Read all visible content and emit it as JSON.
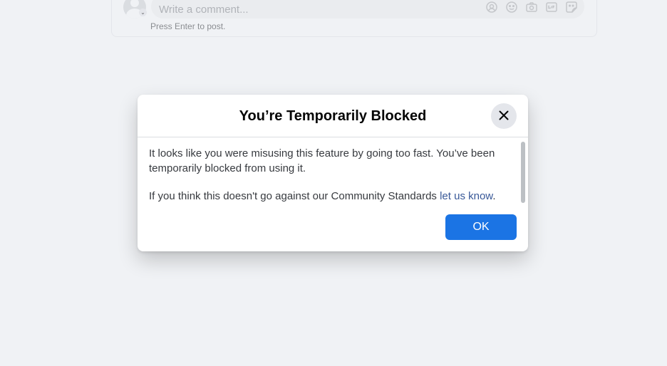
{
  "comment_box": {
    "placeholder": "Write a comment...",
    "hint": "Press Enter to post.",
    "chevron": "⌄",
    "tools": [
      "avatar-sticker-icon",
      "emoji-icon",
      "camera-icon",
      "gif-icon",
      "sticker-icon"
    ]
  },
  "modal": {
    "title": "You’re Temporarily Blocked",
    "paragraph_1": "It looks like you were misusing this feature by going too fast. You’ve been temporarily blocked from using it.",
    "paragraph_2_prefix": "If you think this doesn't go against our Community Standards ",
    "link_label": "let us know",
    "paragraph_2_suffix": ".",
    "ok_label": "OK",
    "close_icon": "close-icon"
  },
  "colors": {
    "background": "#f0f2f5",
    "primary_button": "#1b74e4",
    "link": "#385898",
    "title": "#050505",
    "body_text": "#373a3f"
  }
}
